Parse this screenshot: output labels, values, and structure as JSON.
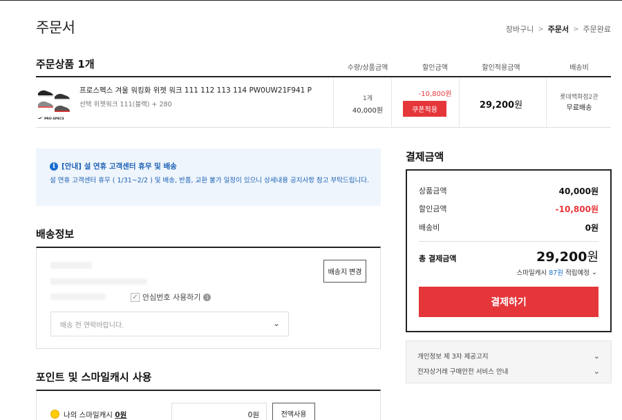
{
  "page": {
    "title": "주문서",
    "breadcrumb": [
      "장바구니",
      "주문서",
      "주문완료"
    ]
  },
  "order": {
    "section_title": "주문상품 1개",
    "columns": [
      "수량/상품금액",
      "할인금액",
      "할인적용금액",
      "배송비"
    ],
    "item": {
      "name": "프로스펙스 겨울 워킹화 위젯 워크 111 112 113 114 PW0UW21F941 P",
      "option": "선택 위젯워크 111(블랙) + 280",
      "quantity": "1개",
      "price": "40,000원",
      "discount": "-10,800원",
      "coupon_label": "쿠폰적용",
      "final_price": "29,200",
      "final_unit": "원",
      "seller": "롯데백화점2관",
      "shipping": "무료배송"
    }
  },
  "notice": {
    "title": "[안내] 설 연휴 고객센터 휴무 및 배송",
    "body": "설 연휴 고객센터 휴무 ( 1/31~2/2 ) 및 배송, 반품, 교환 불가 일정이 있으니 상세내용 공지사항 참고 부탁드립니다."
  },
  "shipping_info": {
    "title": "배송정보",
    "change_address_label": "배송지 변경",
    "safe_number_label": "안심번호 사용하기",
    "memo_placeholder": "배송 전 연락바랍니다."
  },
  "points": {
    "title": "포인트 및 스마일캐시 사용",
    "label_prefix": "나의 스마일캐시 ",
    "balance": "0원",
    "input_value": "0원",
    "use_all_label": "전액사용"
  },
  "payment": {
    "title": "결제금액",
    "rows": [
      {
        "label": "상품금액",
        "value": "40,000원"
      },
      {
        "label": "할인금액",
        "value": "-10,800원"
      },
      {
        "label": "배송비",
        "value": "0원"
      }
    ],
    "total_label": "총 결제금액",
    "total_value": "29,200",
    "total_unit": "원",
    "reward_prefix": "스마일캐시",
    "reward_amount": "87원",
    "reward_suffix": "적립예정",
    "pay_button_label": "결제하기",
    "accent_color": "#e5363a"
  },
  "terms": [
    "개인정보 제 3자 제공고지",
    "전자상거래 구매안전 서비스 안내"
  ]
}
